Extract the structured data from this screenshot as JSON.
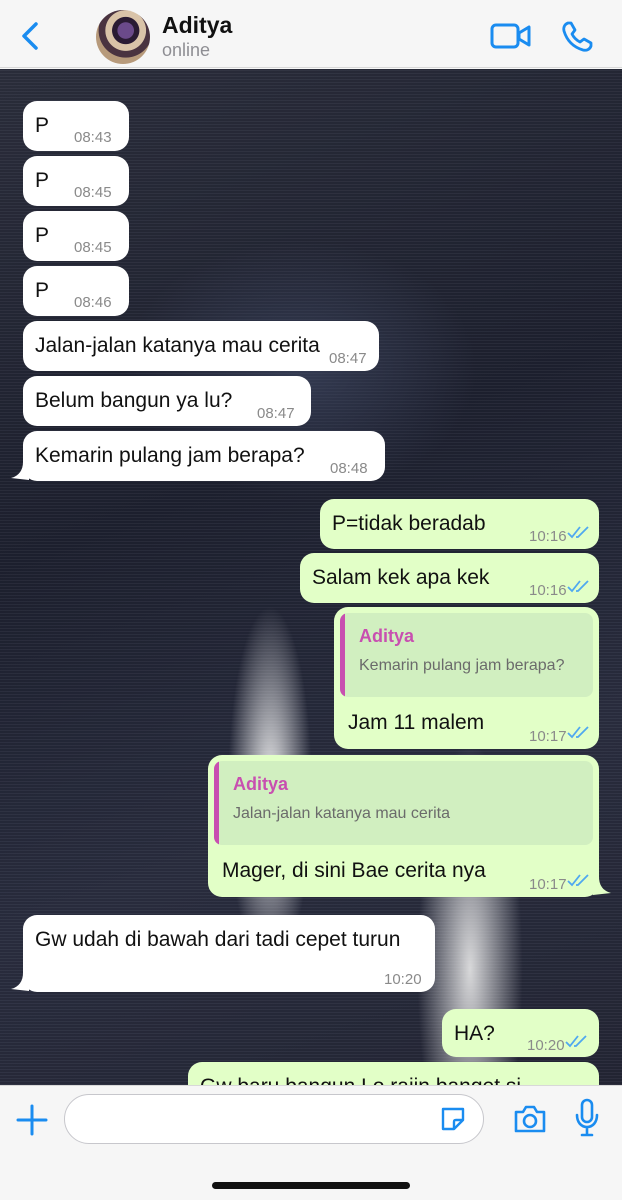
{
  "header": {
    "contact_name": "Aditya",
    "status": "online",
    "back_icon": "chevron-left-icon",
    "video_icon": "video-camera-icon",
    "call_icon": "phone-icon",
    "accent_color": "#1a8cf0"
  },
  "messages": [
    {
      "direction": "in",
      "text": "P",
      "time": "08:43"
    },
    {
      "direction": "in",
      "text": "P",
      "time": "08:45"
    },
    {
      "direction": "in",
      "text": "P",
      "time": "08:45"
    },
    {
      "direction": "in",
      "text": "P",
      "time": "08:46"
    },
    {
      "direction": "in",
      "text": "Jalan-jalan katanya mau cerita",
      "time": "08:47"
    },
    {
      "direction": "in",
      "text": "Belum bangun ya lu?",
      "time": "08:47"
    },
    {
      "direction": "in",
      "text": "Kemarin pulang jam berapa?",
      "time": "08:48"
    },
    {
      "direction": "out",
      "text": "P=tidak beradab",
      "time": "10:16",
      "read": true
    },
    {
      "direction": "out",
      "text": "Salam kek apa kek",
      "time": "10:16",
      "read": true
    },
    {
      "direction": "out",
      "text": "Jam 11 malem",
      "time": "10:17",
      "read": true,
      "reply": {
        "name": "Aditya",
        "text": "Kemarin pulang jam berapa?"
      }
    },
    {
      "direction": "out",
      "text": "Mager, di sini Bae cerita nya",
      "time": "10:17",
      "read": true,
      "reply": {
        "name": "Aditya",
        "text": "Jalan-jalan katanya mau cerita"
      }
    },
    {
      "direction": "in",
      "text": "Gw udah di bawah dari tadi cepet turun",
      "time": "10:20"
    },
    {
      "direction": "out",
      "text": "HA?",
      "time": "10:20",
      "read": true
    },
    {
      "direction": "out",
      "text": "Gw baru bangun Lo rajin banget si",
      "time": ""
    }
  ],
  "composer": {
    "placeholder": "",
    "icons": [
      "plus-icon",
      "sticker-icon",
      "camera-icon",
      "microphone-icon"
    ]
  },
  "colors": {
    "incoming_bubble": "#ffffff",
    "outgoing_bubble": "#e2ffc7",
    "reply_accent": "#c84fb0",
    "read_ticks": "#4fa8f0"
  }
}
